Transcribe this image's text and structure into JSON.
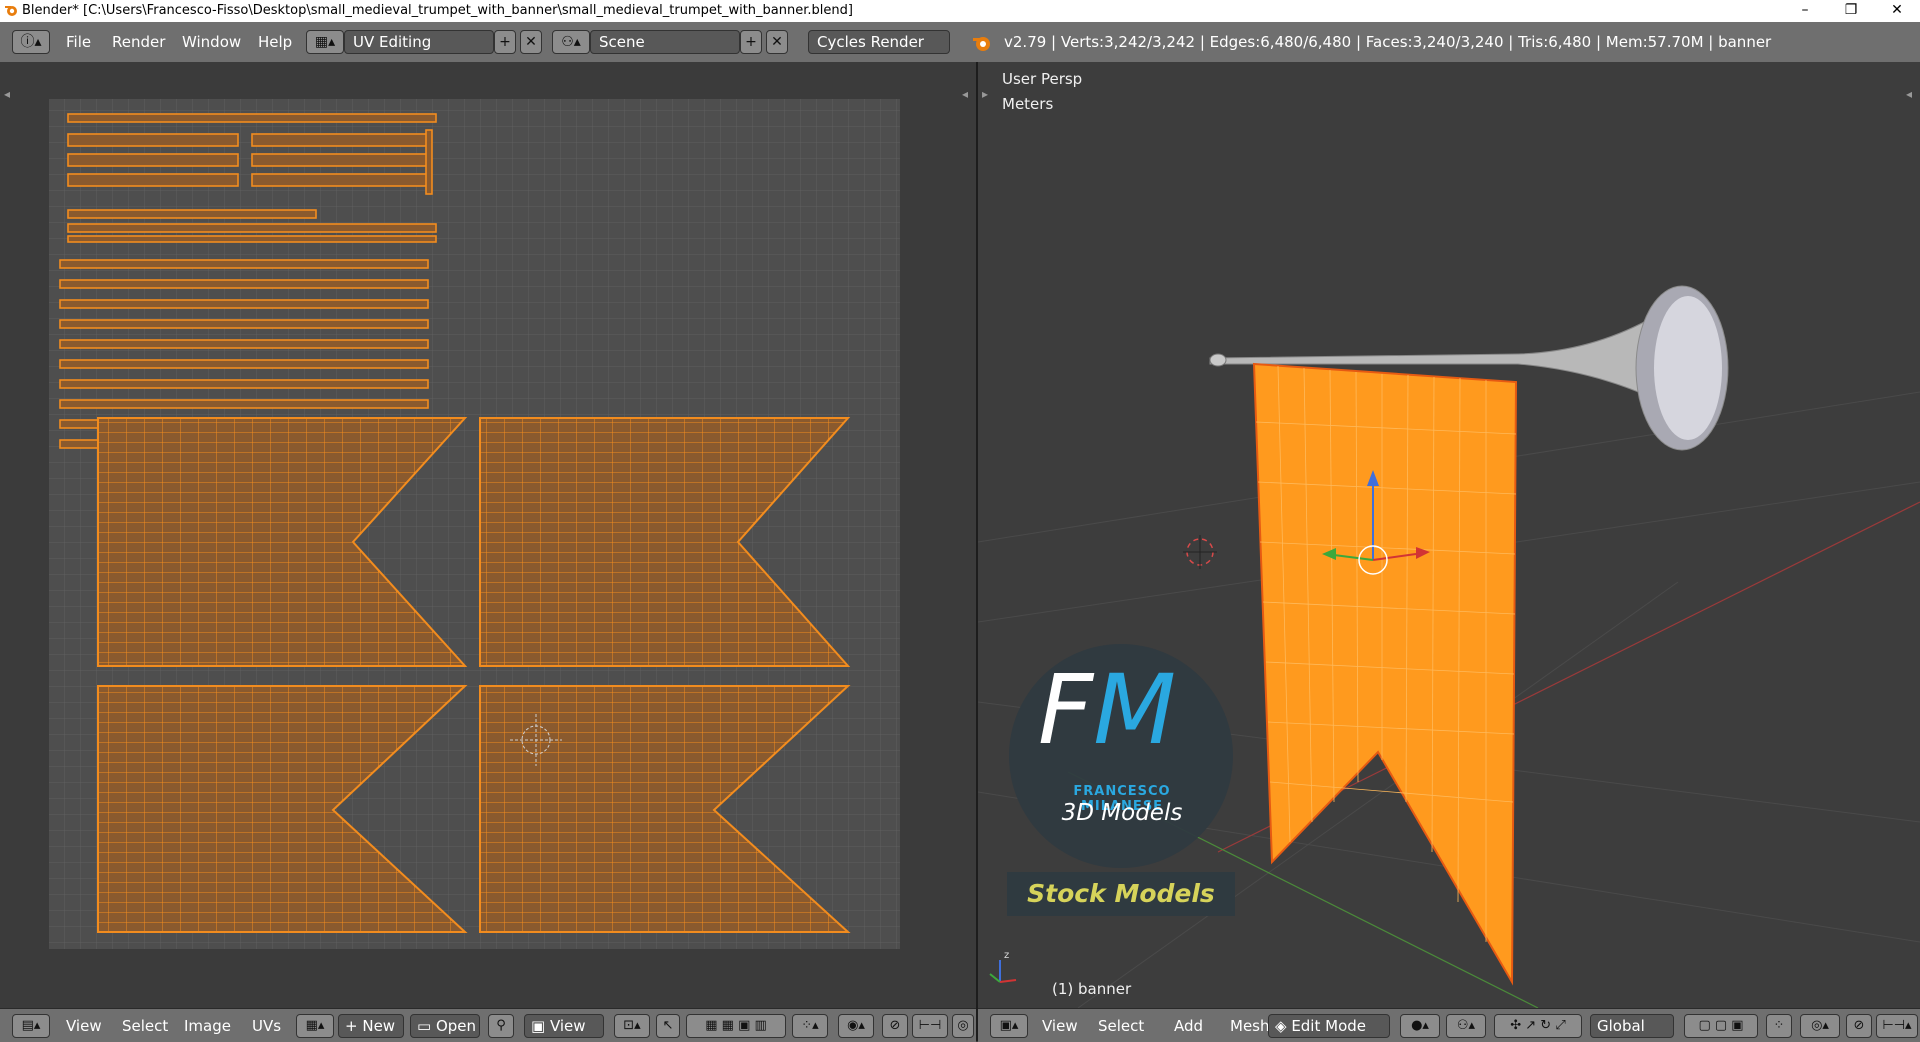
{
  "window": {
    "title": "Blender* [C:\\Users\\Francesco-Fisso\\Desktop\\small_medieval_trumpet_with_banner\\small_medieval_trumpet_with_banner.blend]",
    "minimize": "–",
    "maximize": "❐",
    "close": "✕"
  },
  "topbar": {
    "menus": [
      "File",
      "Render",
      "Window",
      "Help"
    ],
    "screen_layout": "UV Editing",
    "scene": "Scene",
    "render_engine": "Cycles Render",
    "stats": "v2.79 | Verts:3,242/3,242 | Edges:6,480/6,480 | Faces:3,240/3,240 | Tris:6,480 | Mem:57.70M | banner"
  },
  "uv_editor": {
    "menus": [
      "View",
      "Select",
      "Image",
      "UVs"
    ],
    "new_label": "New",
    "open_label": "Open",
    "view_label": "View"
  },
  "viewport": {
    "view_name": "User Persp",
    "units": "Meters",
    "object_label": "(1) banner",
    "menus": [
      "View",
      "Select",
      "Add",
      "Mesh"
    ],
    "mode": "Edit Mode",
    "orientation": "Global"
  },
  "watermark": {
    "monogram": "FM",
    "name": "FRANCESCO MILANESE",
    "tagline": "3D Models",
    "stock": "Stock Models"
  },
  "colors": {
    "uv_orange": "#f28c1e",
    "uv_fill": "#8a5a2e",
    "banner": "#ff9a1e",
    "accent_blue": "#2aa8e0"
  }
}
